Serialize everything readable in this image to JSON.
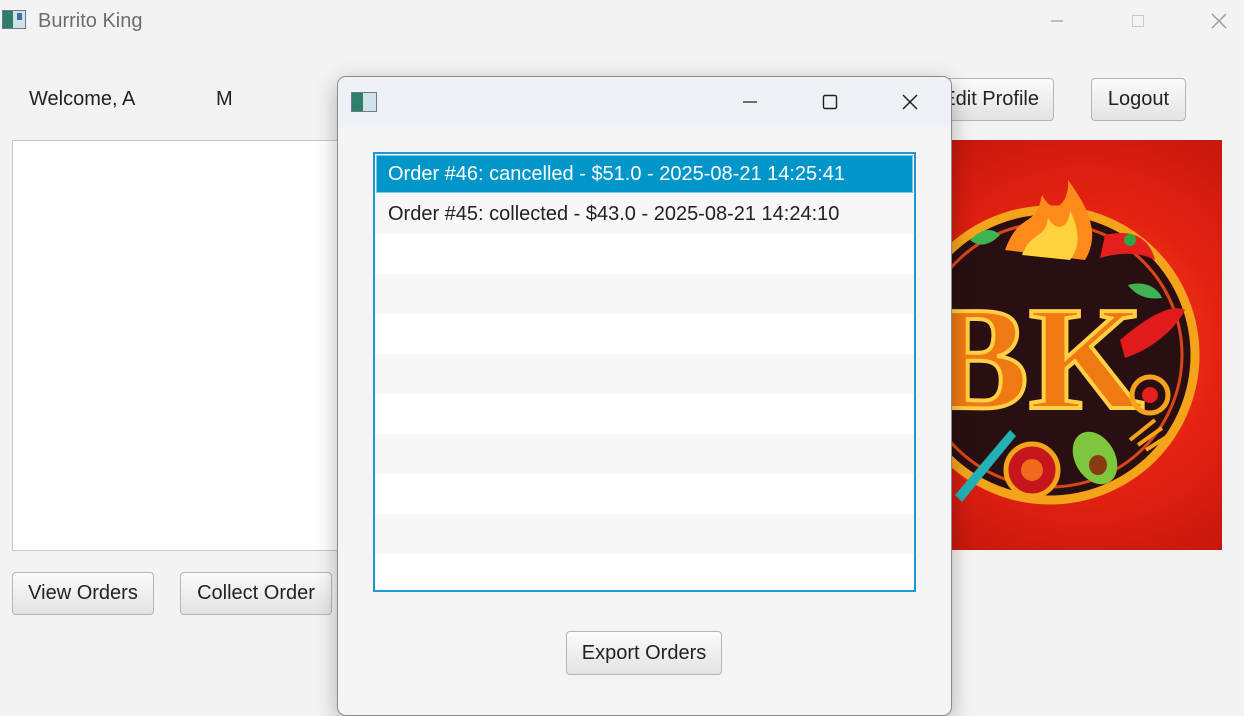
{
  "window": {
    "title": "Burrito King",
    "controls": {
      "minimize": "—",
      "maximize": "☐",
      "close": "✕"
    }
  },
  "header": {
    "welcome_label": "Welcome, A",
    "last_name": "M",
    "edit_profile_label": "Edit Profile",
    "logout_label": "Logout"
  },
  "actions": {
    "view_orders_label": "View Orders",
    "collect_order_label": "Collect Order"
  },
  "logo": {
    "letters": "BK",
    "icon": "burrito-king-logo"
  },
  "dialog": {
    "controls": {
      "minimize": "—",
      "maximize": "☐",
      "close": "✕"
    },
    "orders": [
      {
        "text": "Order #46: cancelled - $51.0 - 2025-08-21 14:25:41",
        "selected": true
      },
      {
        "text": "Order #45: collected - $43.0 - 2025-08-21 14:24:10",
        "selected": false
      }
    ],
    "empty_rows": 9,
    "export_label": "Export Orders"
  },
  "colors": {
    "selection": "#0096c9",
    "focus_border": "#1e98d4"
  }
}
